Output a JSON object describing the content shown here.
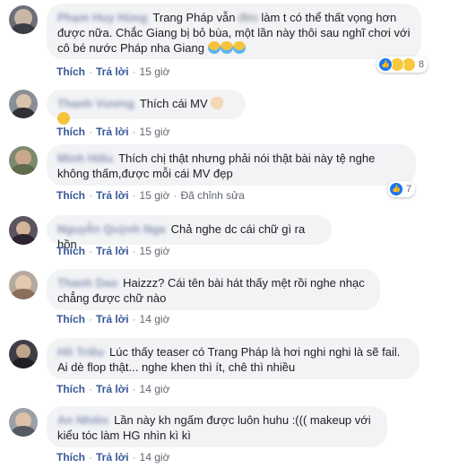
{
  "comments": [
    {
      "name": "Phạm Huy Hùng",
      "text_before": "Trang Pháp vẫn ",
      "blurred": "đéo",
      "text_after": " làm t có thể thất vọng hơn được nữa. Chắc Giang bị bỏ bùa, một lần này thôi sau nghĩ chơi với cô bé nước Pháp nha Giang",
      "emojis": [
        "crying-face",
        "crying-face",
        "crying-face"
      ],
      "like": "Thích",
      "reply": "Trả lời",
      "time": "15 giờ",
      "reactions": {
        "icons": [
          "like",
          "haha",
          "wow"
        ],
        "count": "8"
      }
    },
    {
      "name": "Thanh Vương",
      "text": "Thích cái MV",
      "emojis": [
        "ok-hand",
        "relieved-face"
      ],
      "like": "Thích",
      "reply": "Trả lời",
      "time": "15 giờ"
    },
    {
      "name": "Minh Hiếu",
      "text": "Thích chị thật nhưng phải nói thật bài này tệ nghe không thấm,được mỗi cái MV đẹp",
      "like": "Thích",
      "reply": "Trả lời",
      "time": "15 giờ",
      "edited": "Đã chỉnh sửa",
      "reactions": {
        "icons": [
          "like"
        ],
        "count": "7"
      }
    },
    {
      "name": "Nguyễn Quỳnh Nga",
      "text": "Chả nghe dc cái chữ gì ra hồn",
      "like": "Thích",
      "reply": "Trả lời",
      "time": "15 giờ"
    },
    {
      "name": "Thanh Dao",
      "text": "Haizzz? Cái tên bài hát thấy mệt rồi nghe nhạc chẳng được chữ nào",
      "like": "Thích",
      "reply": "Trả lời",
      "time": "14 giờ"
    },
    {
      "name": "Hồ Triều",
      "text": "Lúc thấy teaser có Trang Pháp là hơi nghi nghi là sẽ fail. Ai dè flop thật... nghe khen thì ít, chê thì nhiều",
      "like": "Thích",
      "reply": "Trả lời",
      "time": "14 giờ"
    },
    {
      "name": "An Nhiên",
      "text": "Lần này kh ngấm được luôn huhu :((( makeup với kiểu tóc làm HG nhìn kì kì",
      "like": "Thích",
      "reply": "Trả lời",
      "time": "14 giờ"
    }
  ],
  "colors": {
    "link": "#385898",
    "bubble": "#f2f3f5",
    "like_blue": "#1877f2",
    "haha_yellow": "#f7c83c"
  }
}
